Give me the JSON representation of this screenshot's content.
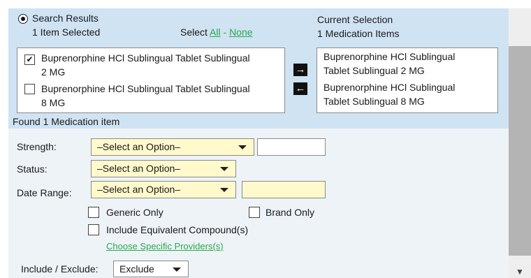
{
  "results": {
    "header": "Search Results",
    "items_selected": "1 Item Selected",
    "select_prefix": "Select",
    "select_all": "All",
    "select_sep": "-",
    "select_none": "None",
    "items": [
      {
        "line1": "Buprenorphine HCl Sublingual Tablet Sublingual",
        "line2": "2 MG",
        "checked": true
      },
      {
        "line1": "Buprenorphine HCl Sublingual Tablet Sublingual",
        "line2": "8 MG",
        "checked": false
      }
    ],
    "found_text": "Found 1 Medication item"
  },
  "current_selection": {
    "header": "Current Selection",
    "count": "1 Medication Items",
    "items": [
      {
        "line1": "Buprenorphine HCl Sublingual",
        "line2": "Tablet Sublingual 2 MG"
      },
      {
        "line1": "Buprenorphine HCl Sublingual",
        "line2": "Tablet Sublingual 8 MG"
      }
    ]
  },
  "transfer": {
    "add_icon": "→",
    "remove_icon": "←"
  },
  "filters": {
    "strength_label": "Strength:",
    "strength_value": "–Select an Option–",
    "strength_text": "",
    "status_label": "Status:",
    "status_value": "–Select an Option–",
    "date_label": "Date Range:",
    "date_value": "–Select an Option–",
    "date_text": "",
    "generic_only": "Generic Only",
    "brand_only": "Brand Only",
    "include_equivalent": "Include Equivalent Compound(s)",
    "providers_link": "Choose Specific Providers(s)",
    "include_exclude_label": "Include / Exclude:",
    "include_exclude_value": "Exclude"
  },
  "colors": {
    "accent_link": "#2aa84a",
    "panel_blue": "#cfe3f3",
    "select_yellow": "#fff9cc"
  },
  "scroll_down_icon": "▼"
}
